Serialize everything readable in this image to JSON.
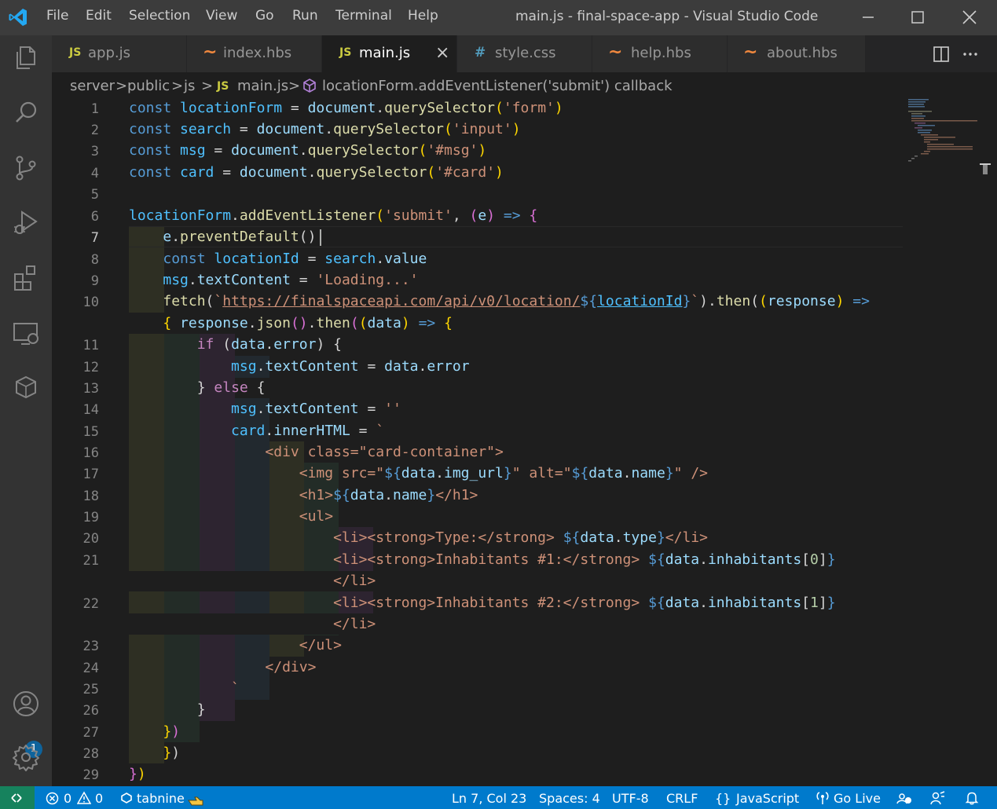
{
  "window": {
    "title": "main.js - final-space-app - Visual Studio Code",
    "menu": [
      "File",
      "Edit",
      "Selection",
      "View",
      "Go",
      "Run",
      "Terminal",
      "Help"
    ]
  },
  "tabs": [
    {
      "icon": "JS",
      "icon_color": "#cbcb41",
      "label": "app.js"
    },
    {
      "icon": "~",
      "icon_color": "#f0883e",
      "label": "index.hbs"
    },
    {
      "icon": "JS",
      "icon_color": "#cbcb41",
      "label": "main.js",
      "active": true,
      "close": "×"
    },
    {
      "icon": "#",
      "icon_color": "#519aba",
      "label": "style.css"
    },
    {
      "icon": "~",
      "icon_color": "#f0883e",
      "label": "help.hbs"
    },
    {
      "icon": "~",
      "icon_color": "#f0883e",
      "label": "about.hbs"
    }
  ],
  "breadcrumb": {
    "items": [
      "server",
      "public",
      "js",
      "main.js",
      "locationForm.addEventListener('submit') callback"
    ],
    "separator": ">",
    "file_icon": "JS"
  },
  "editor": {
    "line_numbers": [
      "1",
      "2",
      "3",
      "4",
      "5",
      "6",
      "7",
      "8",
      "9",
      "10",
      "",
      "11",
      "12",
      "13",
      "14",
      "15",
      "16",
      "17",
      "18",
      "19",
      "20",
      "21",
      "",
      "22",
      "",
      "23",
      "24",
      "25",
      "26",
      "27",
      "28",
      "29"
    ],
    "current_line": "7",
    "url": "https://finalspaceapi.com/api/v0/location/"
  },
  "activity": {
    "badge": "1",
    "icons": [
      "explorer-icon",
      "search-icon",
      "source-control-icon",
      "run-debug-icon",
      "extensions-icon",
      "remote-explorer-icon",
      "docker-icon",
      "accounts-icon",
      "settings-gear-icon"
    ]
  },
  "status": {
    "errors": "0",
    "warnings": "0",
    "tabnine": "tabnine",
    "position": "Ln 7, Col 23",
    "spaces": "Spaces: 4",
    "encoding": "UTF-8",
    "eol": "CRLF",
    "language_braces": "{}",
    "language": "JavaScript",
    "golive": "Go Live"
  },
  "colors": {
    "accent": "#007acc",
    "remote": "#16825d",
    "titlebar": "#3c3c3c",
    "editor_bg": "#1e1e1e",
    "indent_1": "#2e2f23",
    "indent_2": "#232c27",
    "indent_3": "#2d2430",
    "indent_4": "#22292f"
  }
}
